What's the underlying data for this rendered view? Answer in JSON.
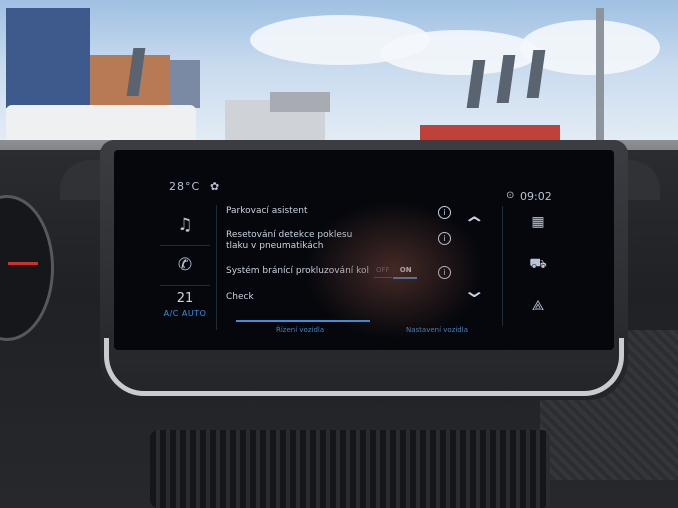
{
  "status_bar": {
    "outside_temp": "28°C",
    "fan_icon": "fan-icon",
    "screen_title": "",
    "clock": "09:02",
    "location_icon": "location-icon"
  },
  "left_sidebar": {
    "items": [
      {
        "icon": "music-note-icon",
        "glyph": "♫"
      },
      {
        "icon": "phone-icon",
        "glyph": "✆"
      }
    ],
    "climate": {
      "temperature": "21",
      "mode_label": "A/C AUTO"
    }
  },
  "settings_list": [
    {
      "label": "Parkovací asistent",
      "has_info": true
    },
    {
      "label": "Resetování detekce poklesu tlaku v pneumatikách",
      "has_info": true
    },
    {
      "label": "Systém bránící prokluzování kol",
      "has_info": true,
      "toggle": {
        "off_label": "OFF",
        "on_label": "ON",
        "value": "ON"
      }
    },
    {
      "label": "Check",
      "has_info": false
    }
  ],
  "scroll": {
    "up_glyph": "⌃",
    "down_glyph": "⌄"
  },
  "right_sidebar": {
    "items": [
      {
        "icon": "apps-grid-icon",
        "glyph": "▦"
      },
      {
        "icon": "car-icon",
        "glyph": "⛟"
      },
      {
        "icon": "navigation-icon",
        "glyph": "⟁"
      }
    ]
  },
  "bottom_tabs": [
    {
      "label": "Řízení vozidla",
      "active": true
    },
    {
      "label": "Nastavení vozidla",
      "active": false
    }
  ],
  "colors": {
    "accent": "#3c8fe0",
    "screen_bg": "#05070c",
    "text": "#c9d3e0"
  }
}
